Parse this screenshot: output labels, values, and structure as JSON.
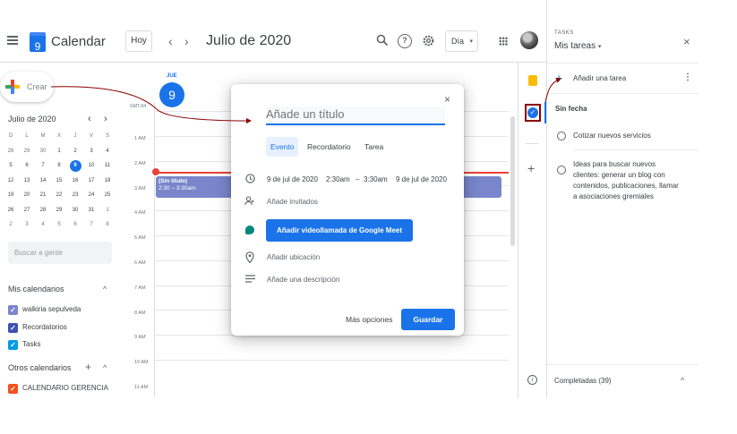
{
  "header": {
    "logo_day": "9",
    "app_title": "Calendar",
    "today_label": "Hoy",
    "prev_label": "‹",
    "next_label": "›",
    "current_date": "Julio de 2020",
    "view_label": "Día",
    "view_caret": "▾"
  },
  "left": {
    "create_label": "Crear",
    "mini_cal": {
      "title": "Julio de 2020",
      "prev": "‹",
      "next": "›",
      "dow": [
        "D",
        "L",
        "M",
        "X",
        "J",
        "V",
        "S"
      ],
      "weeks": [
        [
          "28",
          "29",
          "30",
          "1",
          "2",
          "3",
          "4"
        ],
        [
          "5",
          "6",
          "7",
          "8",
          "9",
          "10",
          "11"
        ],
        [
          "12",
          "13",
          "14",
          "15",
          "16",
          "17",
          "18"
        ],
        [
          "19",
          "20",
          "21",
          "22",
          "23",
          "24",
          "25"
        ],
        [
          "26",
          "27",
          "28",
          "29",
          "30",
          "31",
          "1"
        ],
        [
          "2",
          "3",
          "4",
          "5",
          "6",
          "7",
          "8"
        ]
      ],
      "today": "9"
    },
    "people_search_placeholder": "Buscar a gente",
    "my_calendars_title": "Mis calendarios",
    "my_calendars": [
      {
        "label": "walkiria sepulveda",
        "color": "#7986cb"
      },
      {
        "label": "Recordatorios",
        "color": "#3f51b5"
      },
      {
        "label": "Tasks",
        "color": "#039be5"
      }
    ],
    "other_calendars_title": "Otros calendarios",
    "other_calendars": [
      {
        "label": "CALENDARIO GERENCIA",
        "color": "#f4511e"
      }
    ],
    "caret_up": "^",
    "add_symbol": "+"
  },
  "day_view": {
    "dow": "JUE",
    "day_num": "9",
    "timezone": "GMT-04",
    "times": [
      "1 AM",
      "2 AM",
      "3 AM",
      "4 AM",
      "5 AM",
      "6 AM",
      "7 AM",
      "8 AM",
      "9 AM",
      "10 AM",
      "11 AM"
    ],
    "event": {
      "title": "(Sin título)",
      "time": "2:30 – 3:30am",
      "color": "#7986cb"
    }
  },
  "dialog": {
    "close": "×",
    "title_placeholder": "Añade un título",
    "tabs": [
      "Evento",
      "Recordatorio",
      "Tarea"
    ],
    "active_tab": "Evento",
    "date_start": "9 de jul de 2020",
    "time_start": "2:30am",
    "dash": "–",
    "time_end": "3:30am",
    "date_end": "9 de jul de 2020",
    "guests": "Añade invitados",
    "meet_button": "Añadir videollamada de Google Meet",
    "location": "Añadir ubicación",
    "description": "Añade una descripción",
    "more_options": "Más opciones",
    "save": "Guardar"
  },
  "tasks": {
    "label": "TASKS",
    "list_title": "Mis tareas",
    "list_caret": "▾",
    "close": "×",
    "add_task": "Añadir una tarea",
    "add_plus": "+",
    "kebab": "⋮",
    "section": "Sin fecha",
    "items": [
      "Cotizar nuevos servicios",
      "Ideas para buscar nuevos clientes: generar un blog  con contenidos, publicaciones, llamar a asociaciones gremiales"
    ],
    "completed": "Completadas (39)",
    "completed_caret": "^"
  },
  "rail": {
    "plus": "+",
    "info": "i",
    "tasks_check": "✓"
  },
  "colors": {
    "primary": "#1a73e8",
    "now_line": "#ea4335",
    "annotation": "#8b0000"
  }
}
